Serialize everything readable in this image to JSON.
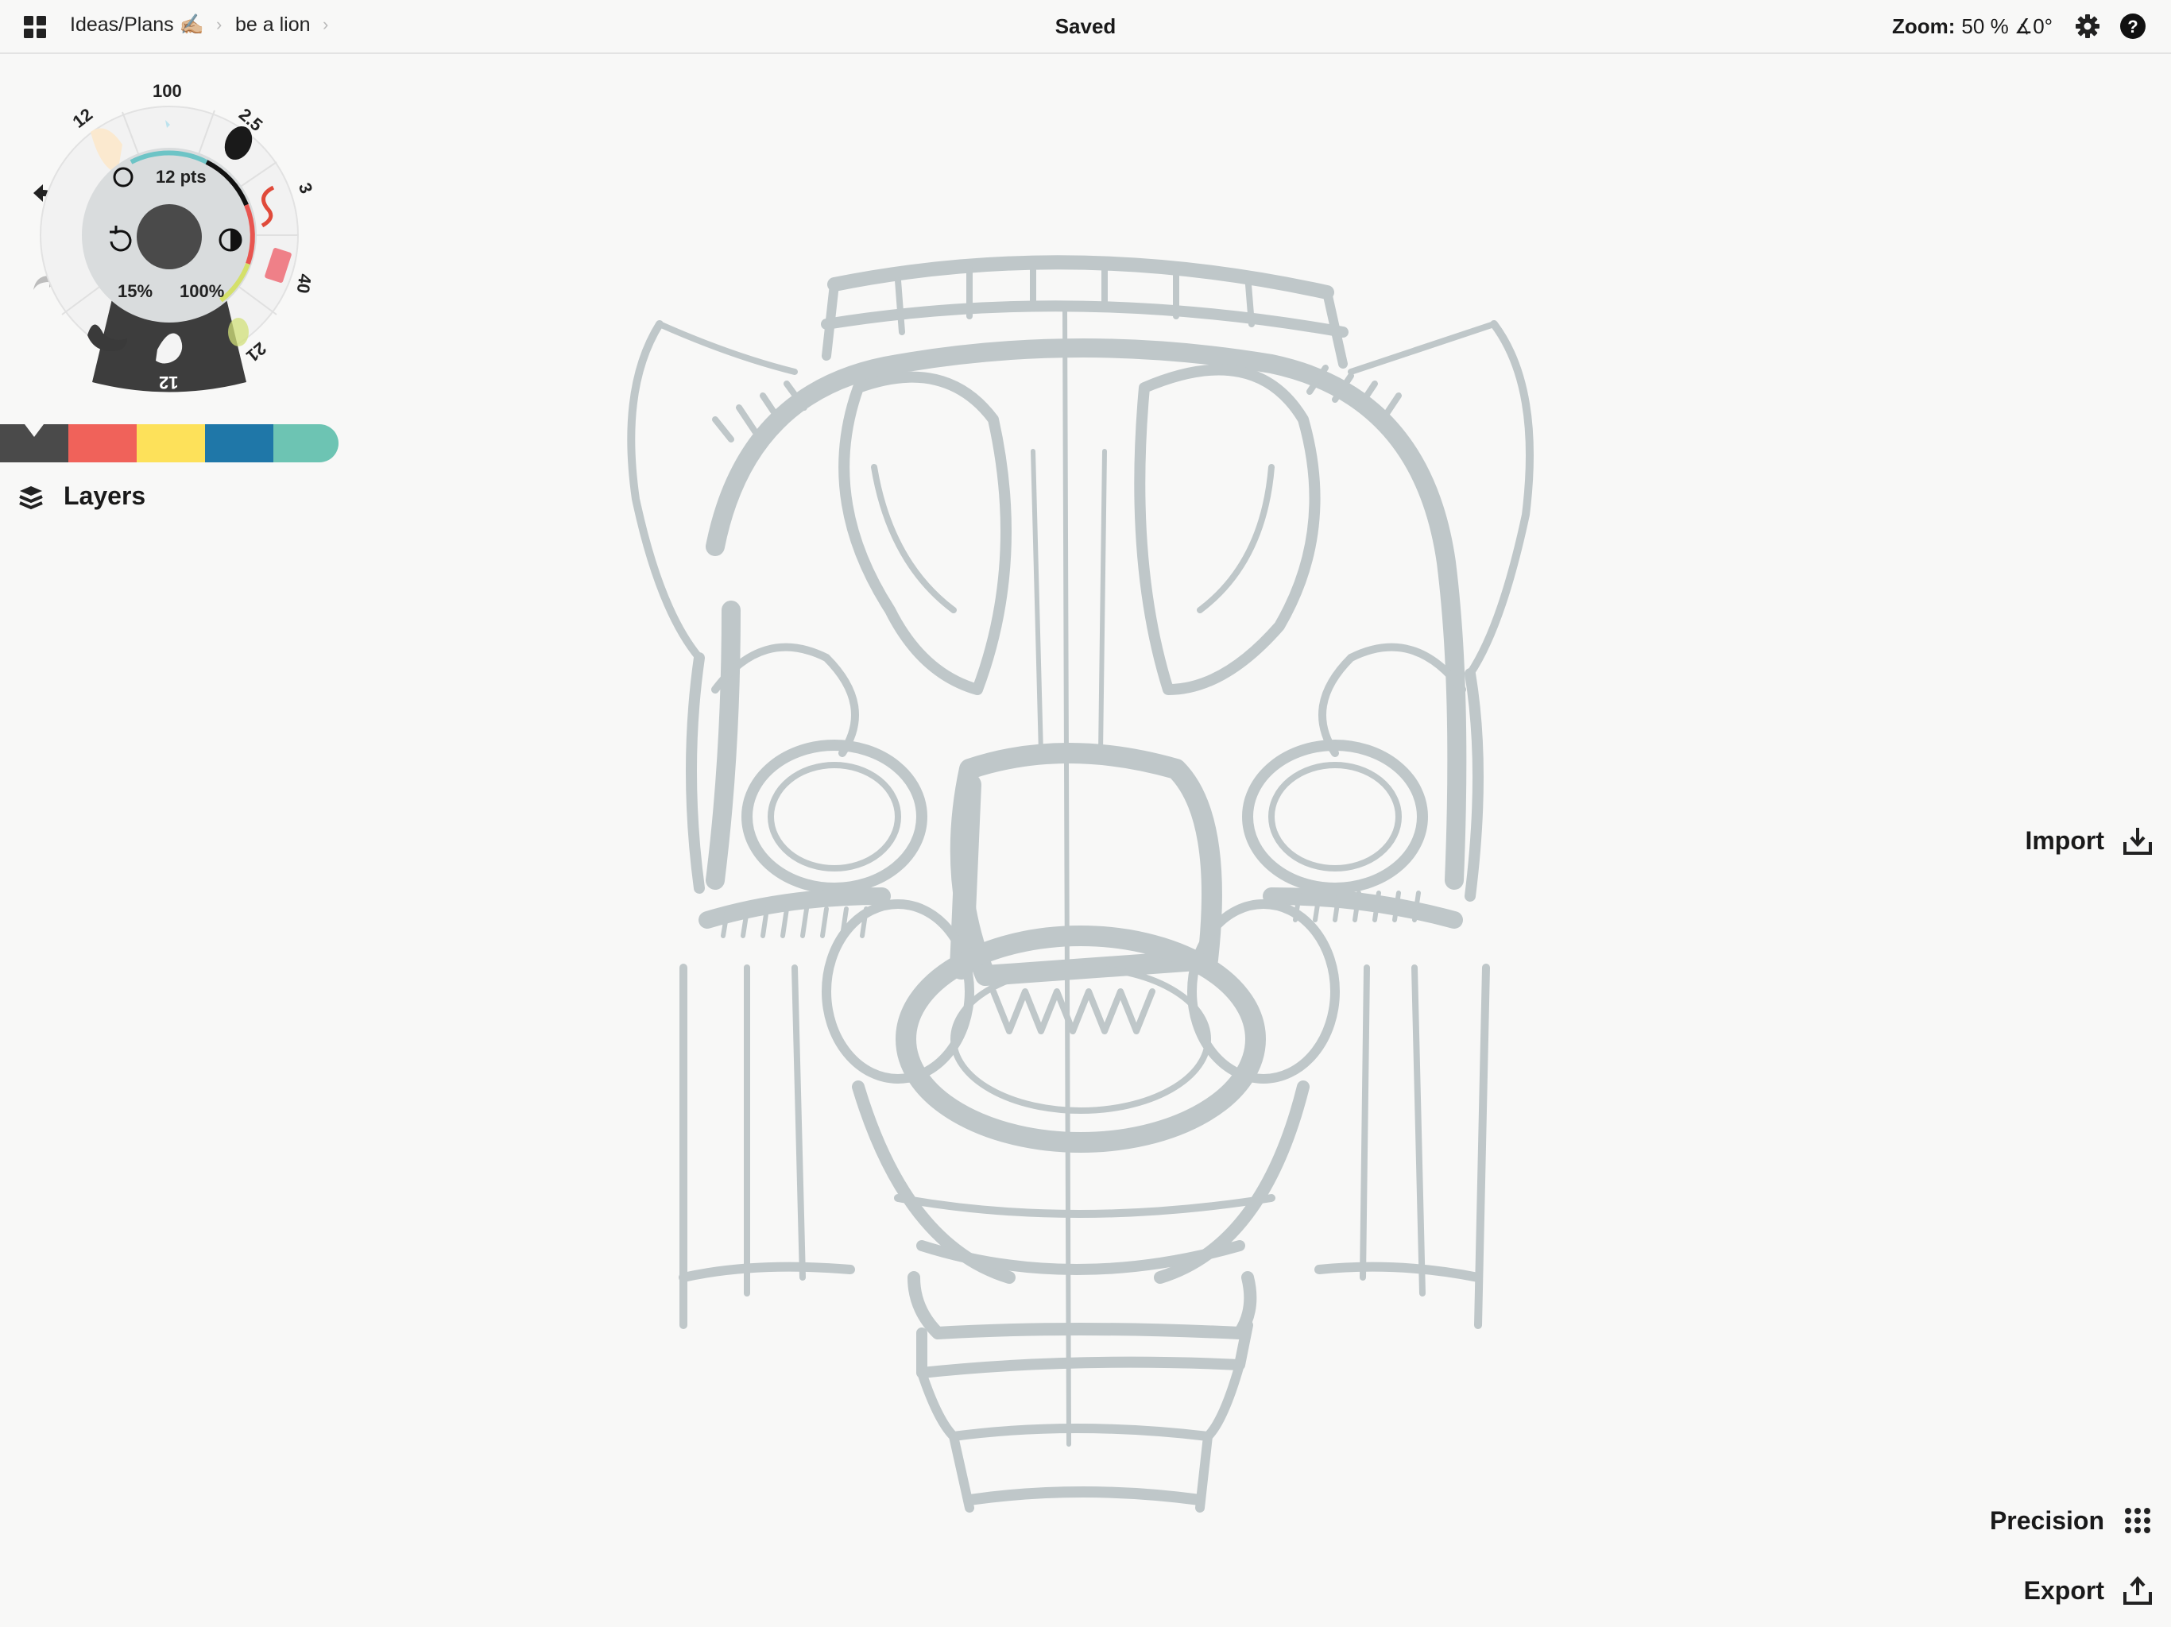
{
  "topbar": {
    "breadcrumb": [
      "Ideas/Plans ✍🏼",
      "be a lion"
    ],
    "status": "Saved",
    "zoom_label": "Zoom:",
    "zoom_value": "50 % ∡0°"
  },
  "brush_wheel": {
    "tool_sizes": [
      "12",
      "100",
      "2.5",
      "3",
      "40",
      "21",
      "12"
    ],
    "brush_size": "12 pts",
    "opacity": "15%",
    "smoothing": "100%",
    "current_color": "#4a4a4a"
  },
  "palette": {
    "colors": [
      "#4a4a4a",
      "#f0625a",
      "#fde15a",
      "#1f77a8",
      "#6dc4b3"
    ],
    "selected_index": 0
  },
  "layers_label": "Layers",
  "right_tools": {
    "import_label": "Import",
    "precision_label": "Precision",
    "export_label": "Export"
  },
  "canvas": {
    "stroke_color": "#bfc7c9"
  }
}
